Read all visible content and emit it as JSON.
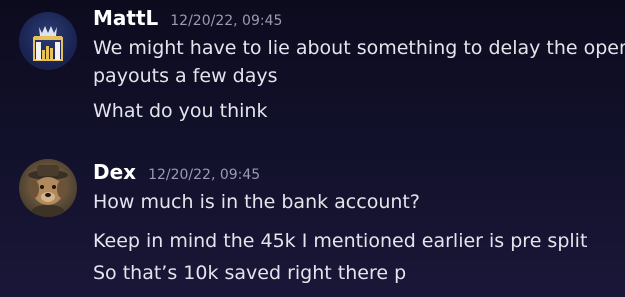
{
  "messages": [
    {
      "username": "MattL",
      "timestamp": "12/20/22, 09:45",
      "avatar_icon": "castle-crown-logo",
      "lines": [
        "We might have to lie about something to delay the open",
        "payouts a few days",
        "What do you think"
      ]
    },
    {
      "username": "Dex",
      "timestamp": "12/20/22, 09:45",
      "avatar_icon": "dog-photo",
      "lines": [
        "How much is in the bank account?",
        "Keep in mind the 45k I mentioned earlier is pre split",
        "So that’s 10k saved right there p"
      ]
    }
  ],
  "colors": {
    "background_top": "#0c0b1e",
    "background_bottom": "#1a1638",
    "username": "#ffffff",
    "timestamp": "#9a9ab0",
    "message_text": "#e4e4ec"
  }
}
